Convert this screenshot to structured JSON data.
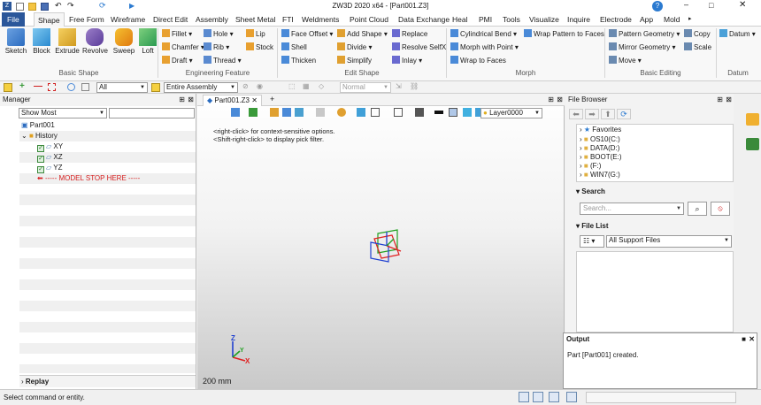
{
  "app": {
    "title": "ZW3D 2020 x64 - [Part001.Z3]"
  },
  "tabs": [
    "File",
    "Shape",
    "Free Form",
    "Wireframe",
    "Direct Edit",
    "Assembly",
    "Sheet Metal",
    "FTI",
    "Weldments",
    "Point Cloud",
    "Data Exchange",
    "Heal",
    "PMI",
    "Tools",
    "Visualize",
    "Inquire",
    "Electrode",
    "App",
    "Mold"
  ],
  "ribbon": {
    "basic_shape": {
      "label": "Basic Shape",
      "items": [
        "Sketch",
        "Block",
        "Extrude",
        "Revolve",
        "Sweep",
        "Loft"
      ]
    },
    "engineering": {
      "label": "Engineering Feature",
      "items": [
        "Fillet",
        "Chamfer",
        "Draft",
        "Hole",
        "Rib",
        "Thread",
        "Lip",
        "Stock"
      ]
    },
    "edit_shape": {
      "label": "Edit Shape",
      "items": [
        "Face Offset",
        "Shell",
        "Thicken",
        "Add Shape",
        "Divide",
        "Simplify",
        "Replace",
        "Resolve SelfX",
        "Inlay"
      ]
    },
    "morph": {
      "label": "Morph",
      "items": [
        "Cylindrical Bend",
        "Morph with Point",
        "Wrap to Faces",
        "Wrap Pattern to Faces"
      ]
    },
    "basic_editing": {
      "label": "Basic Editing",
      "items": [
        "Pattern Geometry",
        "Mirror Geometry",
        "Move",
        "Copy",
        "Scale"
      ]
    },
    "datum": {
      "label": "Datum",
      "items": [
        "Datum"
      ]
    }
  },
  "toolbar2": {
    "filter_value": "All",
    "scope_value": "Entire Assembly",
    "view_value": "Normal"
  },
  "manager": {
    "title": "Manager",
    "filter_value": "Show Most",
    "tree": [
      "Part001",
      "History",
      "XY",
      "XZ",
      "YZ",
      "----- MODEL STOP HERE -----"
    ],
    "replay": "Replay"
  },
  "viewport": {
    "tab": "Part001.Z3",
    "layer": "Layer0000",
    "hint1": "<right-click> for context-sensitive options.",
    "hint2": "<Shift-right-click> to display pick filter.",
    "scale": "200 mm",
    "axis": {
      "x": "X",
      "y": "Y",
      "z": "Z"
    }
  },
  "file_browser": {
    "title": "File Browser",
    "tree": [
      "Favorites",
      "OS10(C:)",
      "DATA(D:)",
      "BOOT(E:)",
      "(F:)",
      "WIN7(G:)"
    ],
    "search_title": "Search",
    "search_placeholder": "Search...",
    "filelist_title": "File List",
    "filter_value": "All Support Files"
  },
  "output": {
    "title": "Output",
    "message": "Part [Part001] created."
  },
  "status": {
    "text": "Select command or entity."
  },
  "colors": {
    "accent": "#2b579a",
    "stop": "#d62020",
    "axis_x": "#e02020",
    "axis_y": "#20a020",
    "axis_z": "#2040d0"
  }
}
